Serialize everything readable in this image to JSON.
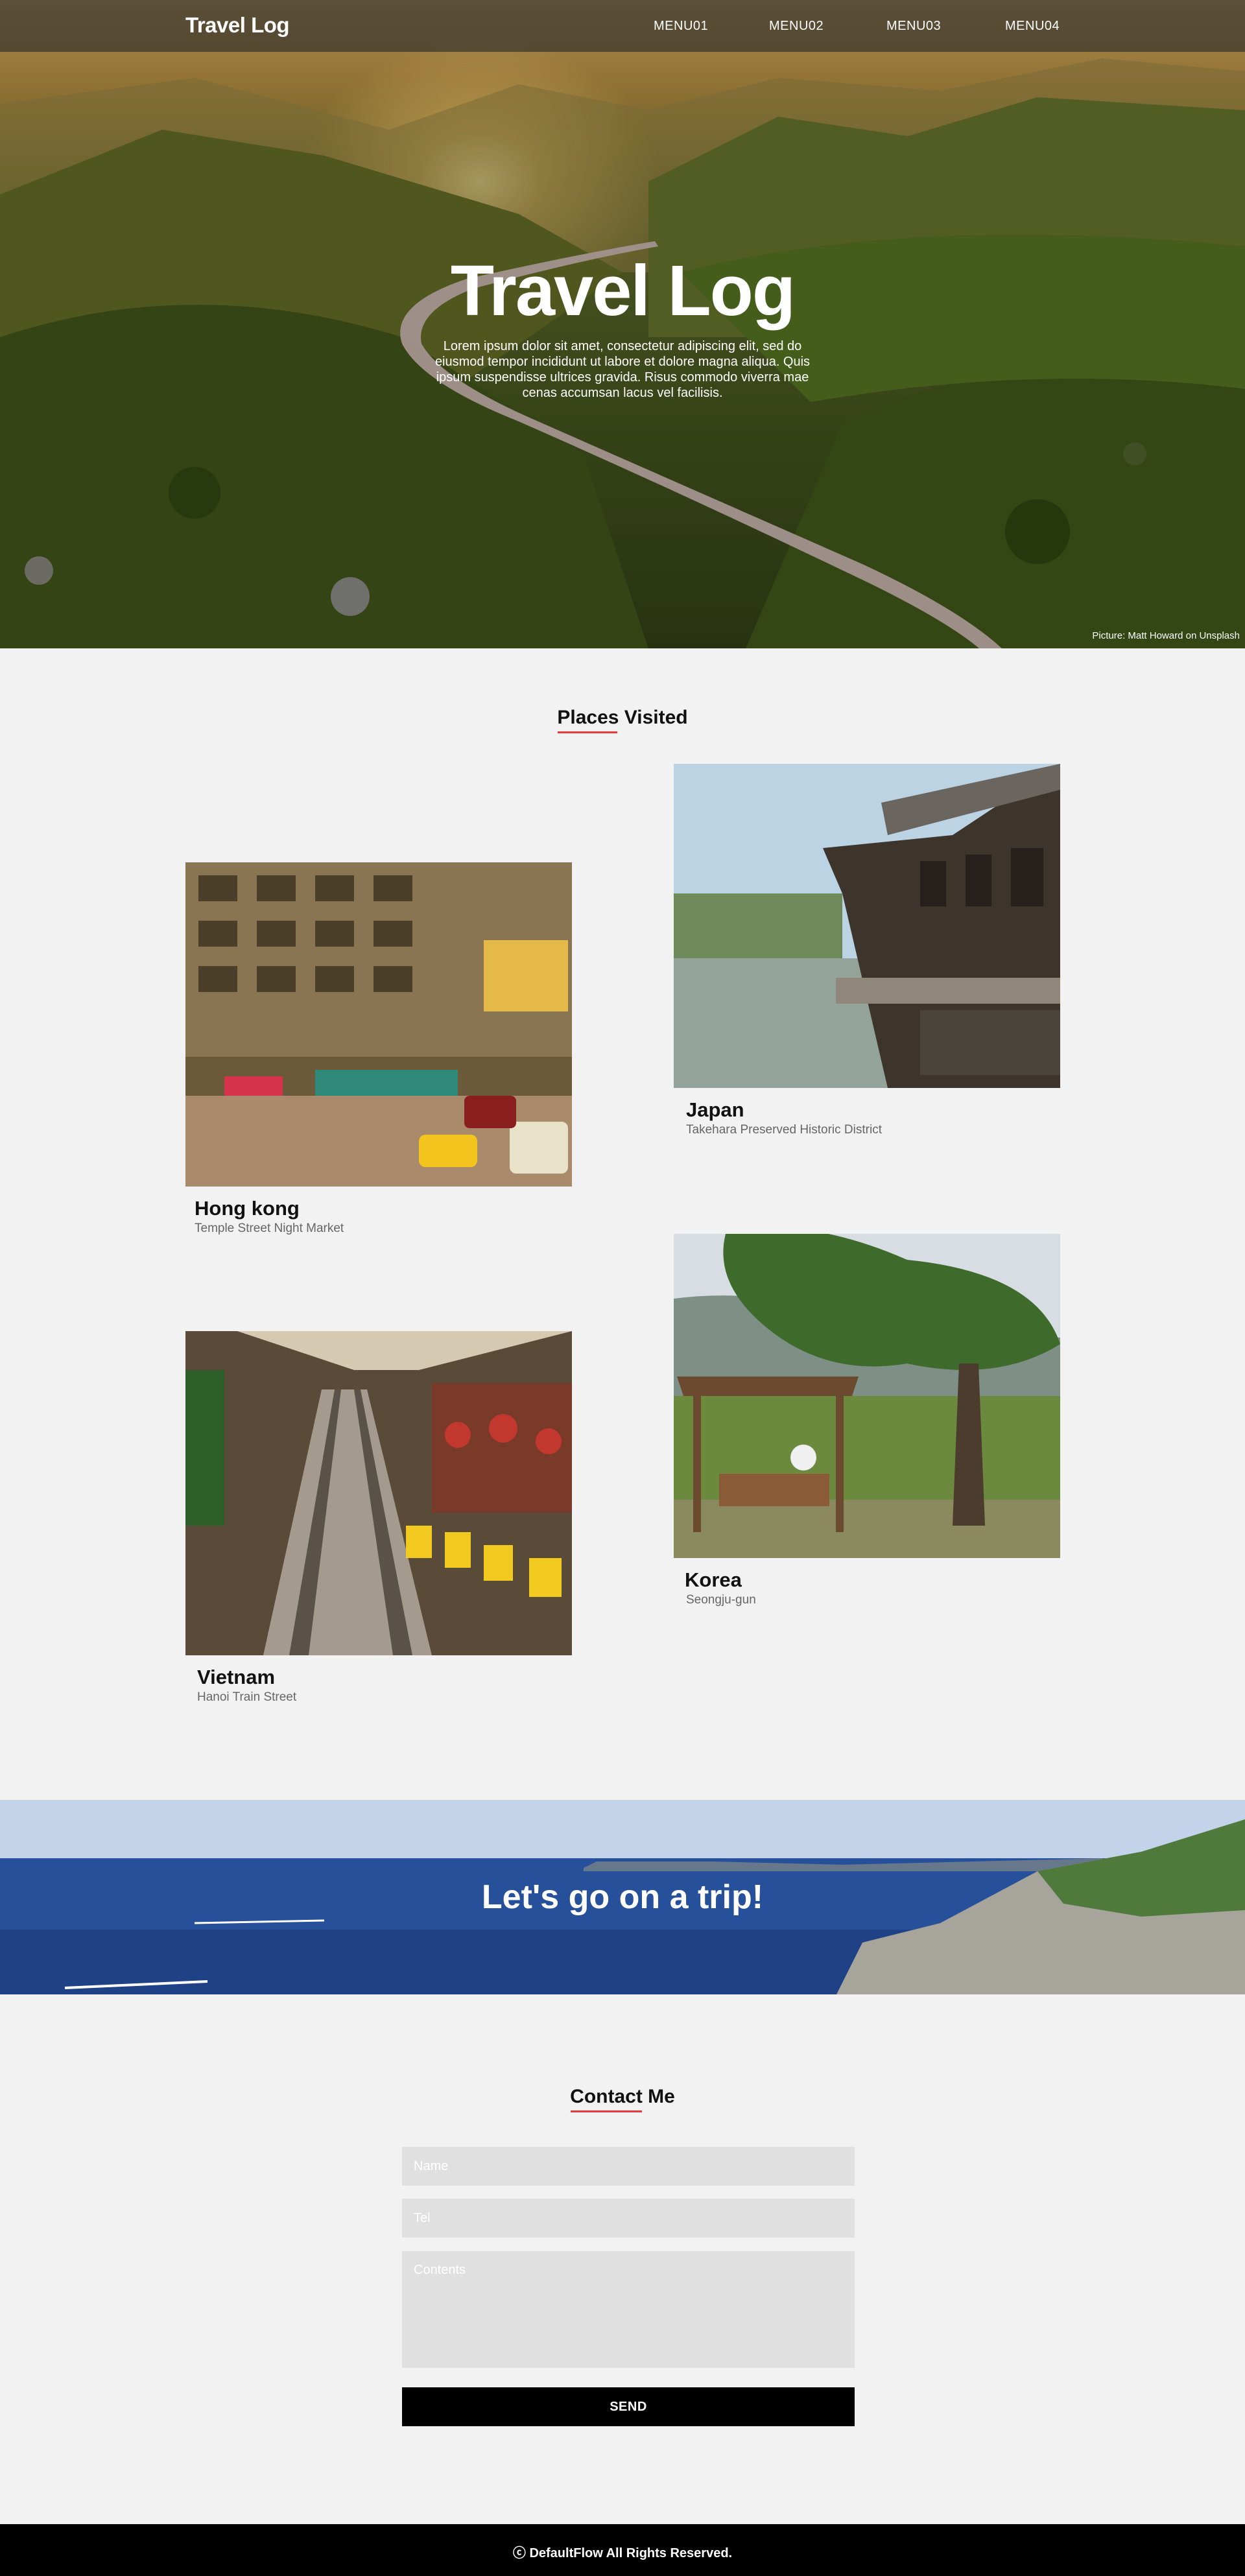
{
  "header": {
    "logo": "Travel Log",
    "menu": [
      "MENU01",
      "MENU02",
      "MENU03",
      "MENU04"
    ]
  },
  "hero": {
    "title": "Travel Log",
    "text": "Lorem ipsum dolor sit amet, consectetur adipiscing elit, sed do eiusmod tempor incididunt ut labore et dolore magna aliqua. Quis ipsum suspendisse ultrices gravida. Risus commodo viverra mae cenas accumsan lacus vel facilisis.",
    "credit": "Picture: Matt Howard on Unsplash"
  },
  "places": {
    "title": "Places Visited",
    "items": [
      {
        "name": "Hong kong",
        "description": "Temple Street Night Market"
      },
      {
        "name": "Japan",
        "description": "Takehara Preserved Historic District"
      },
      {
        "name": "Vietnam",
        "description": "Hanoi Train Street"
      },
      {
        "name": "Korea",
        "description": "Seongju-gun"
      }
    ]
  },
  "banner": {
    "text": "Let's go on a trip!"
  },
  "contact": {
    "title": "Contact Me",
    "name_placeholder": "Name",
    "tel_placeholder": "Tel",
    "contents_placeholder": "Contents",
    "send_label": "SEND"
  },
  "footer": {
    "text": "ⓒ DefaultFlow All Rights Reserved."
  },
  "colors": {
    "accent_underline": "#e83a3a",
    "header_bg": "#3a3a3a",
    "page_bg": "#f2f2f2",
    "field_bg": "#e0e0e0",
    "button_bg": "#000000",
    "footer_bg": "#000000"
  }
}
